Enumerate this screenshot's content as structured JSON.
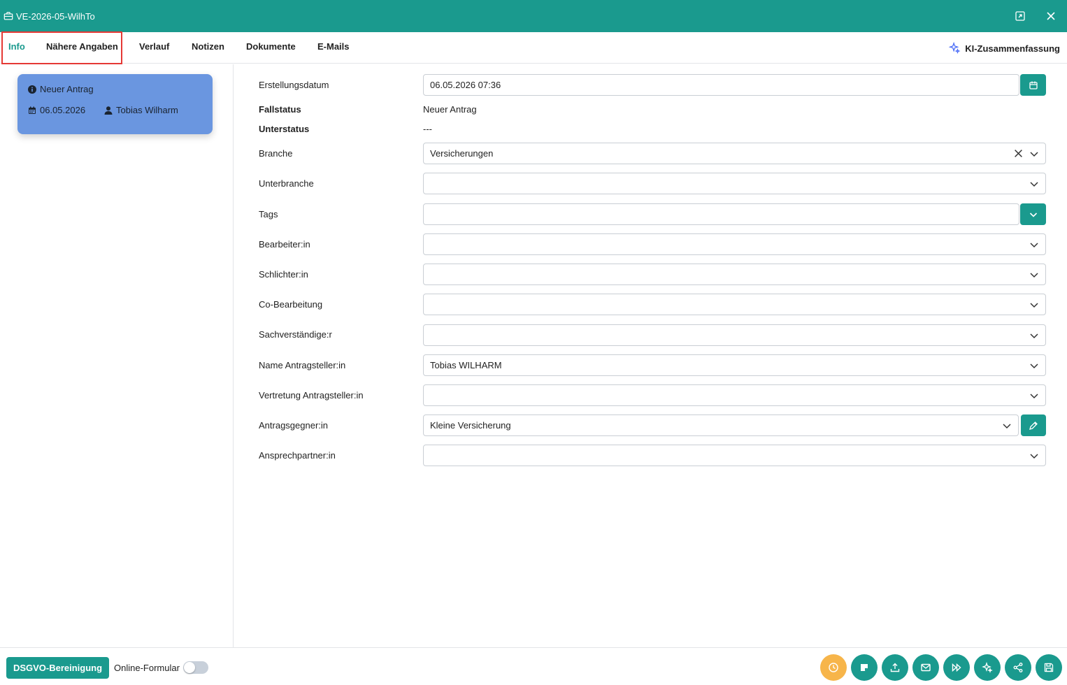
{
  "window": {
    "title": "VE-2026-05-WilhTo"
  },
  "tabs": [
    {
      "label": "Info",
      "active": true
    },
    {
      "label": "Nähere Angaben"
    },
    {
      "label": "Verlauf"
    },
    {
      "label": "Notizen"
    },
    {
      "label": "Dokumente"
    },
    {
      "label": "E-Mails"
    }
  ],
  "ki_summary": {
    "label": "KI-Zusammenfassung"
  },
  "case_card": {
    "status": "Neuer Antrag",
    "date": "06.05.2026",
    "user": "Tobias Wilharm"
  },
  "form": {
    "erstellungsdatum": {
      "label": "Erstellungsdatum",
      "value": "06.05.2026 07:36"
    },
    "fallstatus": {
      "label": "Fallstatus",
      "value": "Neuer Antrag"
    },
    "unterstatus": {
      "label": "Unterstatus",
      "value": "---"
    },
    "branche": {
      "label": "Branche",
      "value": "Versicherungen"
    },
    "unterbranche": {
      "label": "Unterbranche",
      "value": ""
    },
    "tags": {
      "label": "Tags",
      "value": ""
    },
    "bearbeiter": {
      "label": "Bearbeiter:in",
      "value": ""
    },
    "schlichter": {
      "label": "Schlichter:in",
      "value": ""
    },
    "co_bearbeitung": {
      "label": "Co-Bearbeitung",
      "value": ""
    },
    "sachverstaendige": {
      "label": "Sachverständige:r",
      "value": ""
    },
    "name_antragsteller": {
      "label": "Name Antragsteller:in",
      "value": "Tobias WILHARM"
    },
    "vertretung": {
      "label": "Vertretung Antragsteller:in",
      "value": ""
    },
    "antragsgegner": {
      "label": "Antragsgegner:in",
      "value": "Kleine Versicherung"
    },
    "ansprechpartner": {
      "label": "Ansprechpartner:in",
      "value": ""
    }
  },
  "footer": {
    "dsgvo_label": "DSGVO-Bereinigung",
    "online_label": "Online-Formular"
  },
  "colors": {
    "primary": "#1a9a8e",
    "card": "#6a96e0",
    "accent_orange": "#f7b54a",
    "highlight": "#e53935"
  },
  "icons": [
    "briefcase-icon",
    "restore-icon",
    "close-icon",
    "sparkle-icon",
    "info-icon",
    "calendar-icon",
    "user-icon",
    "chevron-down-icon",
    "clear-icon",
    "pencil-icon",
    "clock-icon",
    "note-icon",
    "upload-icon",
    "mail-icon",
    "fast-forward-icon",
    "ai-sparkle-icon",
    "share-icon",
    "save-icon"
  ]
}
